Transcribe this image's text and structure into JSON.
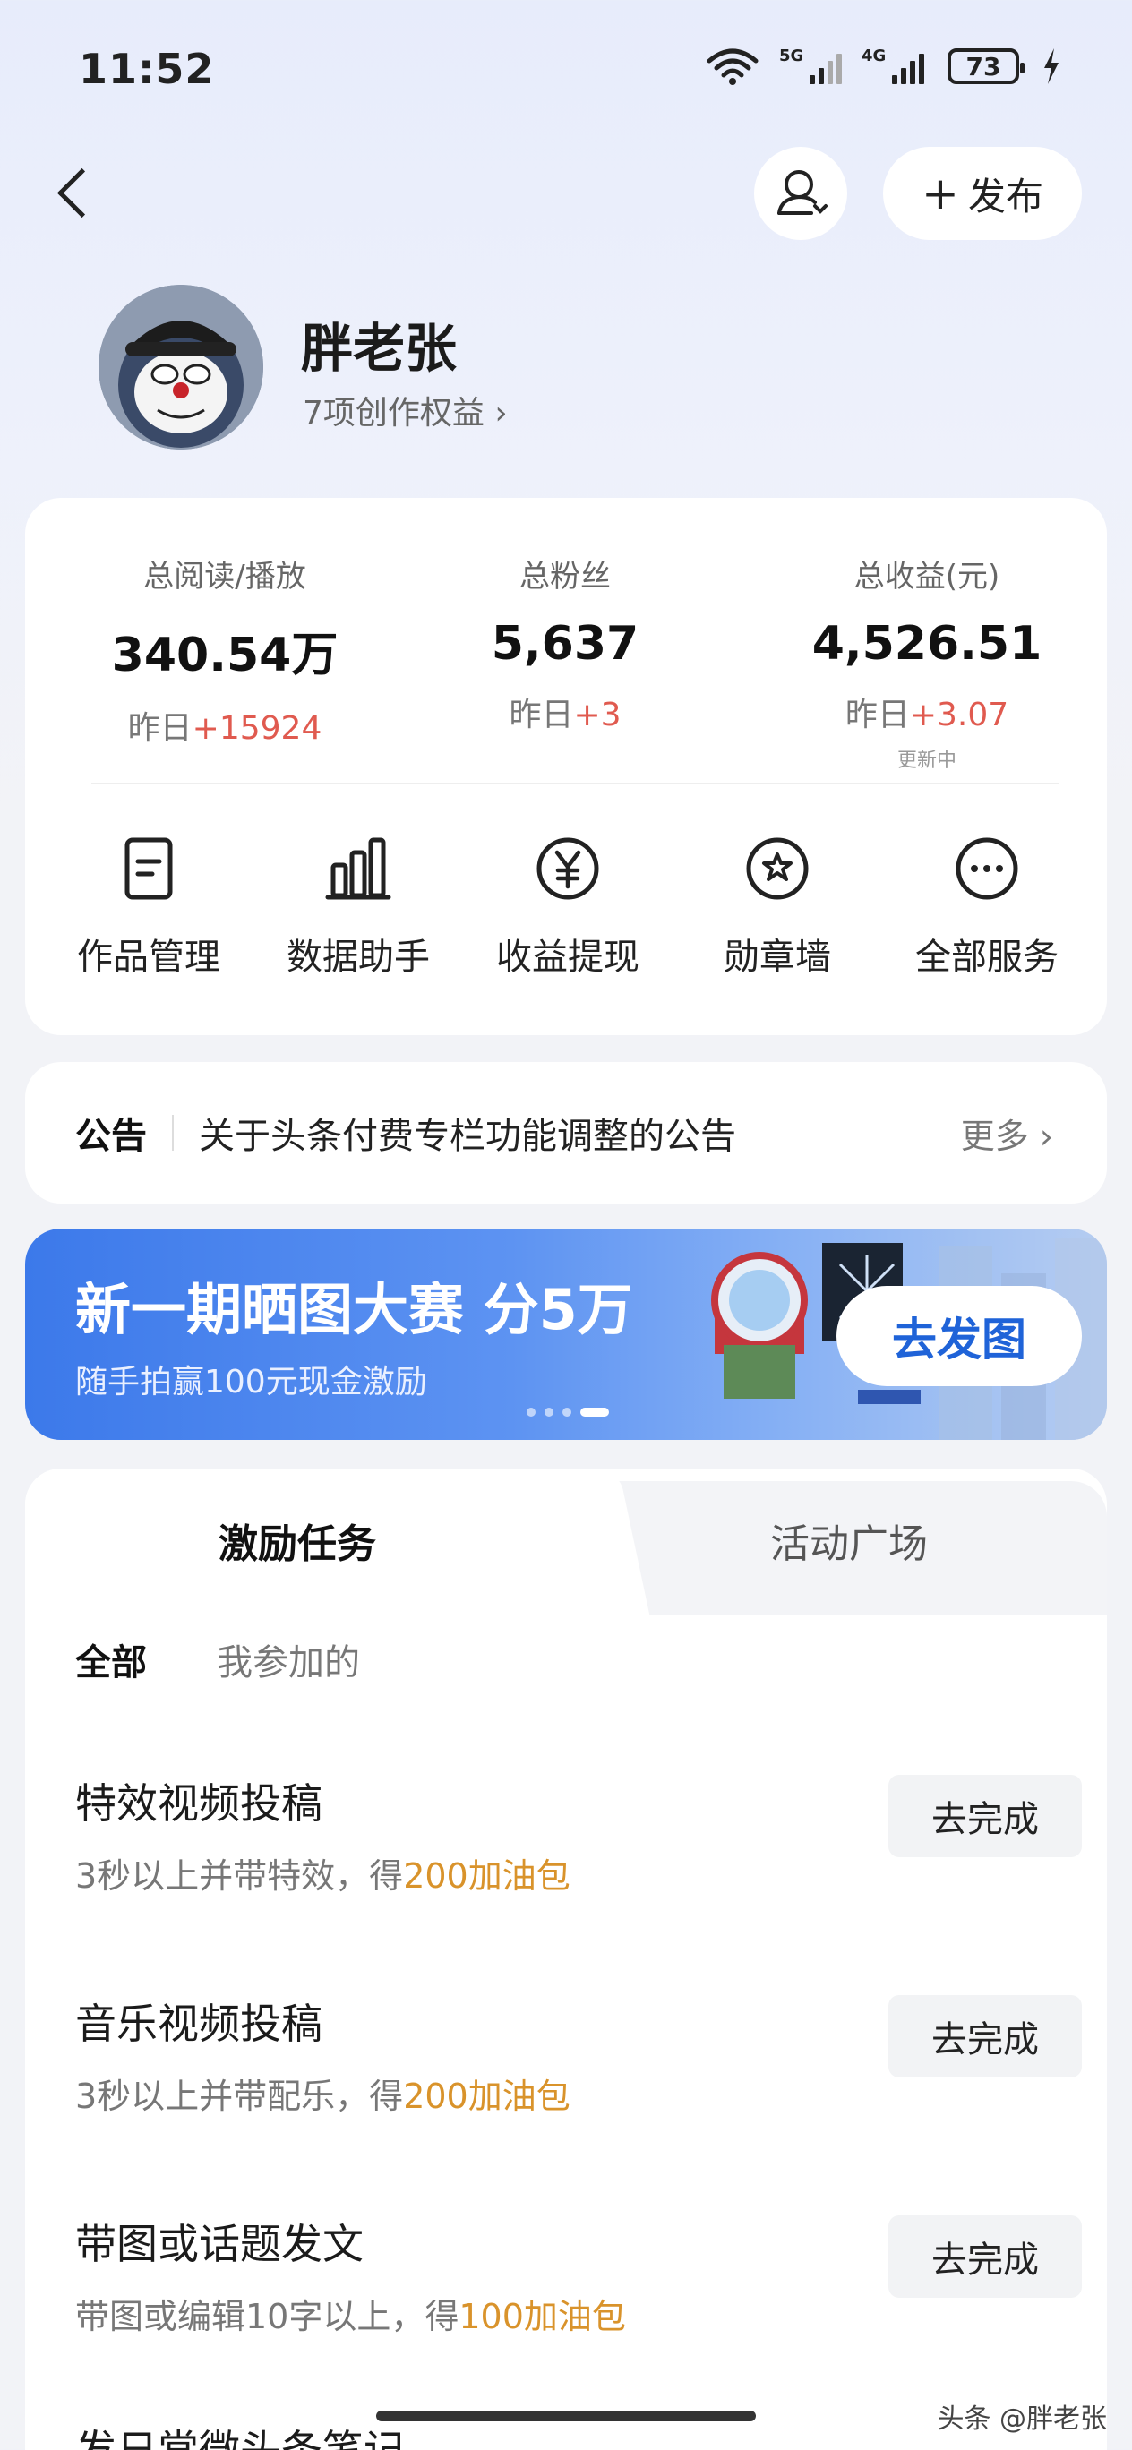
{
  "status_bar": {
    "time": "11:52",
    "signal1_label": "5G",
    "signal2_label": "4G",
    "battery": "73"
  },
  "header": {
    "publish_label": "发布"
  },
  "profile": {
    "name": "胖老张",
    "benefits": "7项创作权益"
  },
  "stats": [
    {
      "title": "总阅读/播放",
      "value": "340.54万",
      "delta_prefix": "昨日",
      "delta": "+15924",
      "note": ""
    },
    {
      "title": "总粉丝",
      "value": "5,637",
      "delta_prefix": "昨日",
      "delta": "+3",
      "note": ""
    },
    {
      "title": "总收益(元)",
      "value": "4,526.51",
      "delta_prefix": "昨日",
      "delta": "+3.07",
      "note": "更新中"
    }
  ],
  "services": [
    {
      "label": "作品管理",
      "icon": "document-icon"
    },
    {
      "label": "数据助手",
      "icon": "bar-chart-icon"
    },
    {
      "label": "收益提现",
      "icon": "yuan-coin-icon"
    },
    {
      "label": "勋章墙",
      "icon": "medal-icon"
    },
    {
      "label": "全部服务",
      "icon": "more-icon"
    }
  ],
  "notice": {
    "tag": "公告",
    "text": "关于头条付费专栏功能调整的公告",
    "more": "更多"
  },
  "banner": {
    "title": "新一期晒图大赛 分5万",
    "subtitle": "随手拍赢100元现金激励",
    "button": "去发图",
    "pages": 4,
    "active_page": 4
  },
  "tasks": {
    "tabs": [
      "激励任务",
      "活动广场"
    ],
    "filters": [
      "全部",
      "我参加的"
    ],
    "items": [
      {
        "title": "特效视频投稿",
        "desc": "3秒以上并带特效，得",
        "reward": "200加油包",
        "button": "去完成"
      },
      {
        "title": "音乐视频投稿",
        "desc": "3秒以上并带配乐，得",
        "reward": "200加油包",
        "button": "去完成"
      },
      {
        "title": "带图或话题发文",
        "desc": "带图或编辑10字以上，得",
        "reward": "100加油包",
        "button": "去完成"
      }
    ],
    "next_partial": "发日常微头条笔记"
  },
  "watermark": "头条 @胖老张",
  "colors": {
    "accent_blue": "#3c79ea",
    "delta_red": "#e05a4f",
    "reward_orange": "#d9932b"
  }
}
